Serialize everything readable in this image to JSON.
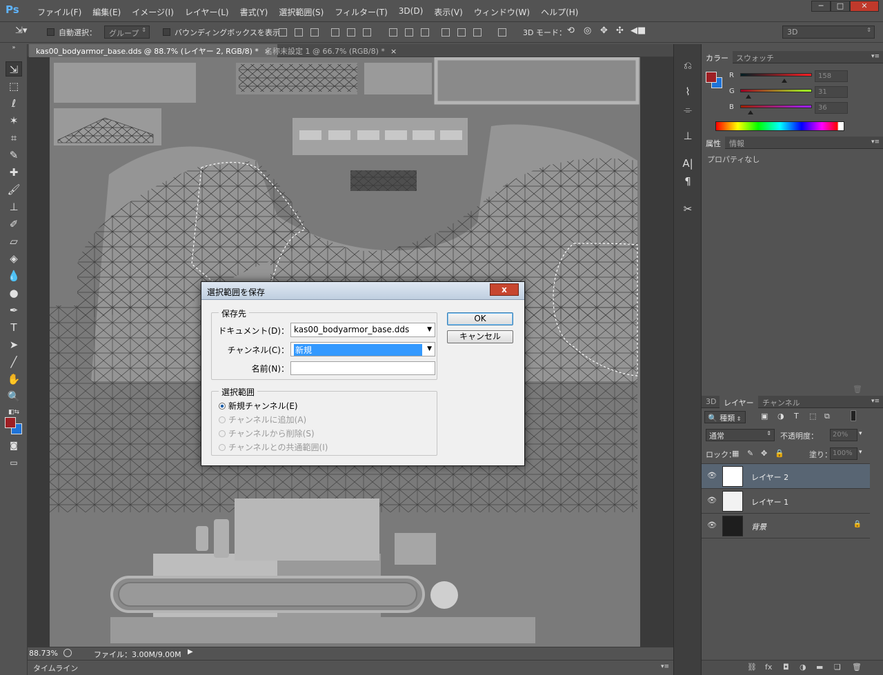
{
  "app": {
    "logo": "Ps"
  },
  "menu": [
    "ファイル(F)",
    "編集(E)",
    "イメージ(I)",
    "レイヤー(L)",
    "書式(Y)",
    "選択範囲(S)",
    "フィルター(T)",
    "3D(D)",
    "表示(V)",
    "ウィンドウ(W)",
    "ヘルプ(H)"
  ],
  "window_buttons": {
    "minimize": "─",
    "maximize": "□",
    "close": "✕"
  },
  "options_bar": {
    "auto_select_label": "自動選択：",
    "group_value": "グループ",
    "bounding_box_label": "バウンディングボックスを表示",
    "mode_3d_label": "3D モード：",
    "workspace": "3D"
  },
  "doc_tabs": [
    {
      "label": "kas00_bodyarmor_base.dds @ 88.7% (レイヤー 2, RGB/8) *",
      "close": "×"
    },
    {
      "label": "名称未設定 1 @ 66.7% (RGB/8) *",
      "close": "×"
    }
  ],
  "status": {
    "zoom": "88.73%",
    "file_info": "ファイル：3.00M/9.00M"
  },
  "timeline_label": "タイムライン",
  "color_panel": {
    "tabs": [
      "カラー",
      "スウォッチ"
    ],
    "channels": [
      {
        "label": "R",
        "value": "158",
        "fraction": 0.62
      },
      {
        "label": "G",
        "value": "31",
        "fraction": 0.12
      },
      {
        "label": "B",
        "value": "36",
        "fraction": 0.14
      }
    ],
    "fg_color": "#9e1f24",
    "bg_color": "#1e73d8"
  },
  "properties_panel": {
    "tabs": [
      "属性",
      "情報"
    ],
    "empty_text": "プロパティなし"
  },
  "layers_panel": {
    "tabs": [
      "3D",
      "レイヤー",
      "チャンネル"
    ],
    "filter_label": "種類",
    "blend_mode": "通常",
    "opacity_label": "不透明度：",
    "opacity_value": "20%",
    "lock_label": "ロック：",
    "fill_label": "塗り：",
    "fill_value": "100%",
    "layers": [
      {
        "name": "レイヤー 2",
        "selected": true
      },
      {
        "name": "レイヤー 1",
        "selected": false
      },
      {
        "name": "背景",
        "selected": false,
        "locked": true
      }
    ]
  },
  "dialog": {
    "title": "選択範囲を保存",
    "close": "x",
    "destination_group": "保存先",
    "document_label": "ドキュメント(D)：",
    "document_value": "kas00_bodyarmor_base.dds",
    "channel_label": "チャンネル(C)：",
    "channel_value": "新規",
    "name_label": "名前(N)：",
    "name_value": "",
    "operation_group": "選択範囲",
    "options": [
      {
        "label": "新規チャンネル(E)",
        "checked": true,
        "enabled": true
      },
      {
        "label": "チャンネルに追加(A)",
        "checked": false,
        "enabled": false
      },
      {
        "label": "チャンネルから削除(S)",
        "checked": false,
        "enabled": false
      },
      {
        "label": "チャンネルとの共通範囲(I)",
        "checked": false,
        "enabled": false
      }
    ],
    "ok_label": "OK",
    "cancel_label": "キャンセル"
  }
}
